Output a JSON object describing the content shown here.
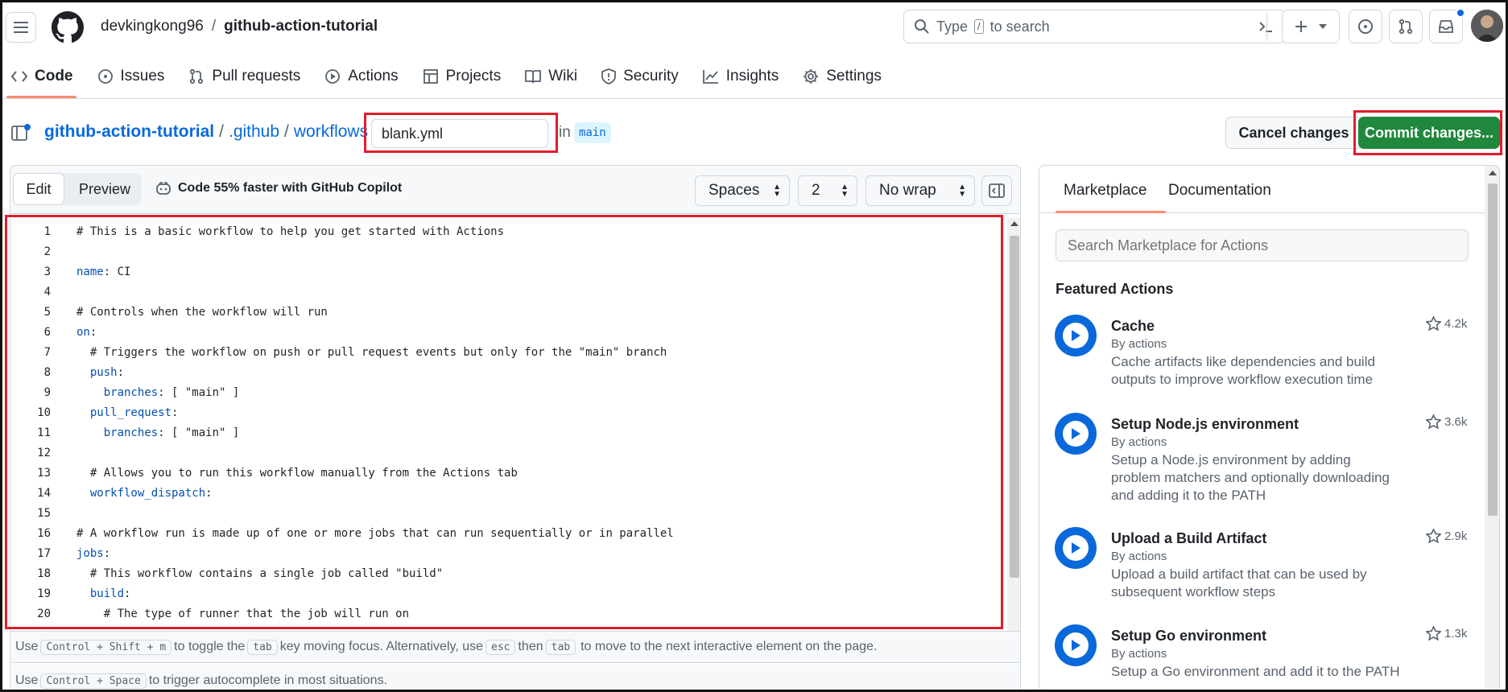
{
  "header": {
    "owner": "devkingkong96",
    "separator": "/",
    "repo": "github-action-tutorial",
    "search_prefix": "Type",
    "search_key": "/",
    "search_suffix": "to search"
  },
  "tabs": [
    {
      "label": "Code",
      "icon": "code-icon"
    },
    {
      "label": "Issues",
      "icon": "issue-icon"
    },
    {
      "label": "Pull requests",
      "icon": "pull-request-icon"
    },
    {
      "label": "Actions",
      "icon": "play-icon"
    },
    {
      "label": "Projects",
      "icon": "table-icon"
    },
    {
      "label": "Wiki",
      "icon": "book-icon"
    },
    {
      "label": "Security",
      "icon": "shield-icon"
    },
    {
      "label": "Insights",
      "icon": "graph-icon"
    },
    {
      "label": "Settings",
      "icon": "gear-icon"
    }
  ],
  "breadcrumb": {
    "repo": "github-action-tutorial",
    "folder1": ".github",
    "folder2": "workflows",
    "sep": "/",
    "filename": "blank.yml",
    "in_label": "in",
    "branch": "main"
  },
  "buttons": {
    "cancel": "Cancel changes",
    "commit": "Commit changes..."
  },
  "editor_toolbar": {
    "edit_tab": "Edit",
    "preview_tab": "Preview",
    "copilot_text": "Code 55% faster with GitHub Copilot",
    "indent_mode": "Spaces",
    "indent_size": "2",
    "wrap_mode": "No wrap"
  },
  "code_lines": [
    {
      "n": "1",
      "parts": [
        {
          "t": "# This is a basic workflow to help you get started with Actions",
          "k": "comment"
        }
      ]
    },
    {
      "n": "2",
      "parts": []
    },
    {
      "n": "3",
      "parts": [
        {
          "t": "name",
          "k": "key"
        },
        {
          "t": ": CI",
          "k": "plain"
        }
      ]
    },
    {
      "n": "4",
      "parts": []
    },
    {
      "n": "5",
      "parts": [
        {
          "t": "# Controls when the workflow will run",
          "k": "comment"
        }
      ]
    },
    {
      "n": "6",
      "parts": [
        {
          "t": "on",
          "k": "key"
        },
        {
          "t": ":",
          "k": "plain"
        }
      ]
    },
    {
      "n": "7",
      "parts": [
        {
          "t": "  # Triggers the workflow on push or pull request events but only for the \"main\" branch",
          "k": "comment"
        }
      ]
    },
    {
      "n": "8",
      "parts": [
        {
          "t": "  ",
          "k": "plain"
        },
        {
          "t": "push",
          "k": "key"
        },
        {
          "t": ":",
          "k": "plain"
        }
      ]
    },
    {
      "n": "9",
      "parts": [
        {
          "t": "    ",
          "k": "plain"
        },
        {
          "t": "branches",
          "k": "key"
        },
        {
          "t": ": [ \"main\" ]",
          "k": "plain"
        }
      ]
    },
    {
      "n": "10",
      "parts": [
        {
          "t": "  ",
          "k": "plain"
        },
        {
          "t": "pull_request",
          "k": "key"
        },
        {
          "t": ":",
          "k": "plain"
        }
      ]
    },
    {
      "n": "11",
      "parts": [
        {
          "t": "    ",
          "k": "plain"
        },
        {
          "t": "branches",
          "k": "key"
        },
        {
          "t": ": [ \"main\" ]",
          "k": "plain"
        }
      ]
    },
    {
      "n": "12",
      "parts": []
    },
    {
      "n": "13",
      "parts": [
        {
          "t": "  # Allows you to run this workflow manually from the Actions tab",
          "k": "comment"
        }
      ]
    },
    {
      "n": "14",
      "parts": [
        {
          "t": "  ",
          "k": "plain"
        },
        {
          "t": "workflow_dispatch",
          "k": "key"
        },
        {
          "t": ":",
          "k": "plain"
        }
      ]
    },
    {
      "n": "15",
      "parts": []
    },
    {
      "n": "16",
      "parts": [
        {
          "t": "# A workflow run is made up of one or more jobs that can run sequentially or in parallel",
          "k": "comment"
        }
      ]
    },
    {
      "n": "17",
      "parts": [
        {
          "t": "jobs",
          "k": "key"
        },
        {
          "t": ":",
          "k": "plain"
        }
      ]
    },
    {
      "n": "18",
      "parts": [
        {
          "t": "  # This workflow contains a single job called \"build\"",
          "k": "comment"
        }
      ]
    },
    {
      "n": "19",
      "parts": [
        {
          "t": "  ",
          "k": "plain"
        },
        {
          "t": "build",
          "k": "key"
        },
        {
          "t": ":",
          "k": "plain"
        }
      ]
    },
    {
      "n": "20",
      "parts": [
        {
          "t": "    # The type of runner that the job will run on",
          "k": "comment"
        }
      ]
    }
  ],
  "hints": {
    "line1_use": "Use",
    "line1_k1": "Control + Shift + m",
    "line1_mid": "to toggle the",
    "line1_k2": "tab",
    "line1_mid2": "key moving focus. Alternatively, use",
    "line1_k3": "esc",
    "line1_then": "then",
    "line1_k4": "tab",
    "line1_end": "to move to the next interactive element on the page.",
    "line2_use": "Use",
    "line2_k1": "Control + Space",
    "line2_end": "to trigger autocomplete in most situations."
  },
  "sidebar": {
    "tab_marketplace": "Marketplace",
    "tab_documentation": "Documentation",
    "search_placeholder": "Search Marketplace for Actions",
    "featured_title": "Featured Actions",
    "actions": [
      {
        "title": "Cache",
        "by": "By actions",
        "desc1": "Cache artifacts like dependencies and build",
        "desc2": "outputs to improve workflow execution time",
        "desc3": "",
        "stars": "4.2k"
      },
      {
        "title": "Setup Node.js environment",
        "by": "By actions",
        "desc1": "Setup a Node.js environment by adding",
        "desc2": "problem matchers and optionally downloading",
        "desc3": "and adding it to the PATH",
        "stars": "3.6k"
      },
      {
        "title": "Upload a Build Artifact",
        "by": "By actions",
        "desc1": "Upload a build artifact that can be used by",
        "desc2": "subsequent workflow steps",
        "desc3": "",
        "stars": "2.9k"
      },
      {
        "title": "Setup Go environment",
        "by": "By actions",
        "desc1": "Setup a Go environment and add it to the PATH",
        "desc2": "",
        "desc3": "",
        "stars": "1.3k"
      }
    ]
  },
  "colors": {
    "accent_blue": "#0969da",
    "commit_green": "#1f883d",
    "highlight_red": "#e11d2a",
    "tab_underline": "#fd8c73"
  }
}
